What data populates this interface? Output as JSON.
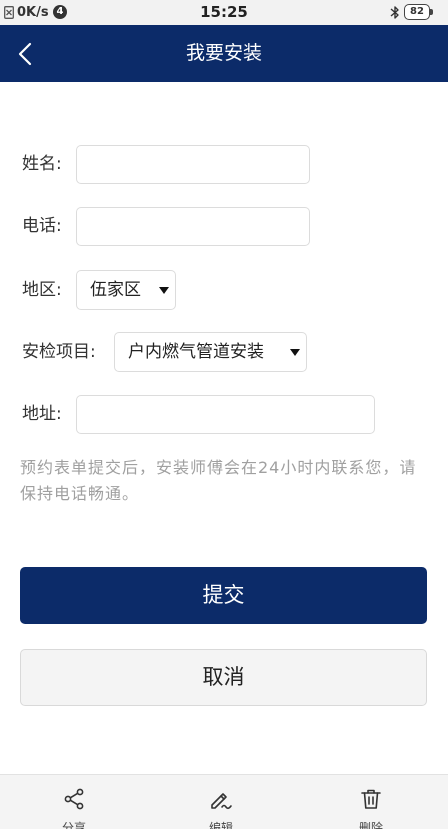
{
  "status_bar": {
    "net_speed": "0K/s",
    "notification_count": "4",
    "time": "15:25",
    "battery": "82"
  },
  "header": {
    "title": "我要安装",
    "back_icon": "chevron-left-icon"
  },
  "form": {
    "name": {
      "label": "姓名:",
      "value": ""
    },
    "phone": {
      "label": "电话:",
      "value": ""
    },
    "district": {
      "label": "地区:",
      "selected": "伍家区"
    },
    "project": {
      "label": "安检项目:",
      "selected": "户内燃气管道安装"
    },
    "address": {
      "label": "地址:",
      "value": ""
    }
  },
  "notice": "预约表单提交后，安装师傅会在24小时内联系您，请保持电话畅通。",
  "buttons": {
    "submit": "提交",
    "cancel": "取消"
  },
  "toolbar": {
    "items": [
      {
        "label": "分享",
        "icon": "share-icon"
      },
      {
        "label": "编辑",
        "icon": "edit-icon"
      },
      {
        "label": "删除",
        "icon": "trash-icon"
      }
    ]
  },
  "colors": {
    "brand": "#0c2b69",
    "notice_text": "#a0a0a0",
    "toolbar_bg": "#f4f4f4"
  }
}
